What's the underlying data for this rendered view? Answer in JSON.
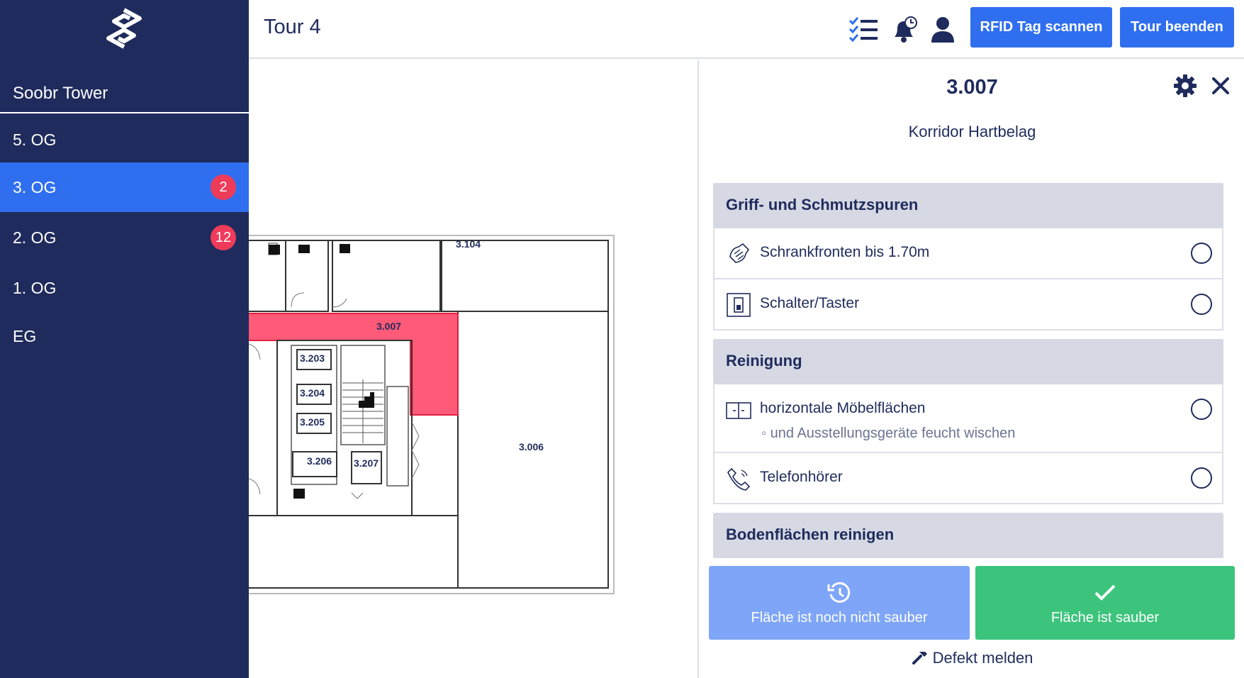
{
  "sidebar": {
    "building": "Soobr Tower",
    "floors": [
      {
        "label": "5. OG",
        "badge": ""
      },
      {
        "label": "3. OG",
        "badge": "2",
        "active": true
      },
      {
        "label": "2. OG",
        "badge": "12"
      },
      {
        "label": "1. OG",
        "badge": ""
      },
      {
        "label": "EG",
        "badge": ""
      }
    ]
  },
  "header": {
    "title": "Tour 4",
    "scan_button": "RFID Tag scannen",
    "end_button": "Tour beenden"
  },
  "plan": {
    "rooms": [
      "3.104",
      "3.007",
      "3.203",
      "3.204",
      "3.205",
      "3.206",
      "3.207",
      "3.006"
    ],
    "highlight_color": "#ff5a78"
  },
  "panel": {
    "room_id": "3.007",
    "room_type": "Korridor Hartbelag",
    "sections": [
      {
        "title": "Griff- und Schmutzspuren",
        "items": [
          {
            "label": "Schrankfronten bis 1.70m",
            "sub": "",
            "icon": "hand-wipe-icon"
          },
          {
            "label": "Schalter/Taster",
            "sub": "",
            "icon": "switch-icon"
          }
        ]
      },
      {
        "title": "Reinigung",
        "items": [
          {
            "label": "horizontale Möbelflächen",
            "sub": "◦ und Ausstellungsgeräte feucht wischen",
            "icon": "furniture-icon"
          },
          {
            "label": "Telefonhörer",
            "sub": "",
            "icon": "phone-icon"
          }
        ]
      },
      {
        "title": "Bodenflächen reinigen",
        "items": []
      }
    ],
    "not_clean_button": "Fläche ist noch nicht sauber",
    "clean_button": "Fläche ist sauber",
    "defect_link": "Defekt melden"
  },
  "colors": {
    "sidebar": "#1f2b5c",
    "accent": "#2f6fef",
    "badge": "#ef3b5a",
    "clean": "#3cc47c",
    "not_clean": "#7ea5f7"
  }
}
